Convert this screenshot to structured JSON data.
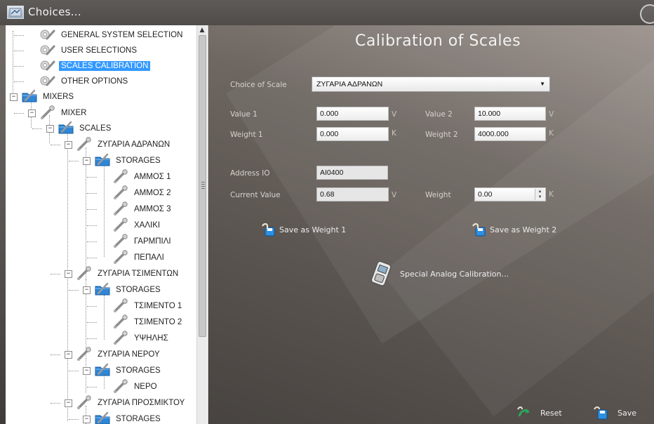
{
  "window": {
    "title": "Choices..."
  },
  "tree": {
    "items": [
      {
        "label": "GENERAL SYSTEM SELECTION",
        "icon": "wrench-gear-icon"
      },
      {
        "label": "USER SELECTIONS",
        "icon": "wrench-gear-icon"
      },
      {
        "label": "SCALES CALIBRATION",
        "icon": "wrench-gear-icon",
        "selected": true
      },
      {
        "label": "OTHER OPTIONS",
        "icon": "wrench-gear-icon"
      },
      {
        "label": "MIXERS",
        "icon": "folder-wrench-icon",
        "expander": "−"
      },
      {
        "label": "MIXER",
        "icon": "wrench-icon",
        "expander": "−"
      },
      {
        "label": "SCALES",
        "icon": "folder-wrench-icon",
        "expander": "−"
      },
      {
        "label": "ΖΥΓΑΡΙΑ ΑΔΡΑΝΩΝ",
        "icon": "wrench-icon",
        "expander": "−"
      },
      {
        "label": "STORAGES",
        "icon": "folder-wrench-icon",
        "expander": "−"
      },
      {
        "label": "ΑΜΜΟΣ 1",
        "icon": "wrench-icon"
      },
      {
        "label": "ΑΜΜΟΣ 2",
        "icon": "wrench-icon"
      },
      {
        "label": "ΑΜΜΟΣ 3",
        "icon": "wrench-icon"
      },
      {
        "label": "ΧΑΛΙΚΙ",
        "icon": "wrench-icon"
      },
      {
        "label": "ΓΑΡΜΠΙΛΙ",
        "icon": "wrench-icon"
      },
      {
        "label": "ΠΕΠΑΛΙ",
        "icon": "wrench-icon"
      },
      {
        "label": "ΖΥΓΑΡΙΑ ΤΣΙΜΕΝΤΩΝ",
        "icon": "wrench-icon",
        "expander": "−"
      },
      {
        "label": "STORAGES",
        "icon": "folder-wrench-icon",
        "expander": "−"
      },
      {
        "label": "ΤΣΙΜΕΝΤΟ 1",
        "icon": "wrench-icon"
      },
      {
        "label": "ΤΣΙΜΕΝΤΟ 2",
        "icon": "wrench-icon"
      },
      {
        "label": "ΥΨΗΛΗΣ",
        "icon": "wrench-icon"
      },
      {
        "label": "ΖΥΓΑΡΙΑ ΝΕΡΟΥ",
        "icon": "wrench-icon",
        "expander": "−"
      },
      {
        "label": "STORAGES",
        "icon": "folder-wrench-icon",
        "expander": "−"
      },
      {
        "label": "ΝΕΡΟ",
        "icon": "wrench-icon"
      },
      {
        "label": "ΖΥΓΑΡΙΑ ΠΡΟΣΜΙΚΤΟΥ",
        "icon": "wrench-icon",
        "expander": "−"
      },
      {
        "label": "STORAGES",
        "icon": "folder-wrench-icon",
        "expander": "−"
      }
    ]
  },
  "form": {
    "title": "Calibration of Scales",
    "choice_label": "Choice of Scale",
    "choice_value": "ΖΥΓΑΡΙΑ ΑΔΡΑΝΩΝ",
    "value1_label": "Value 1",
    "value1": "0.000",
    "value1_unit": "V",
    "value2_label": "Value 2",
    "value2": "10.000",
    "value2_unit": "V",
    "weight1_label": "Weight 1",
    "weight1": "0.000",
    "weight1_unit": "K",
    "weight2_label": "Weight 2",
    "weight2": "4000.000",
    "weight2_unit": "K",
    "address_label": "Address IO",
    "address": "AI0400",
    "current_label": "Current Value",
    "current": "0.68",
    "current_unit": "V",
    "weight_label": "Weight",
    "weight": "0.00",
    "weight_unit": "K"
  },
  "actions": {
    "save_weight1": "Save as Weight 1",
    "save_weight2": "Save as Weight 2",
    "special": "Special Analog Calibration...",
    "reset": "Reset",
    "save": "Save"
  },
  "colors": {
    "selection": "#3399ff",
    "background": "#5d5a57"
  }
}
